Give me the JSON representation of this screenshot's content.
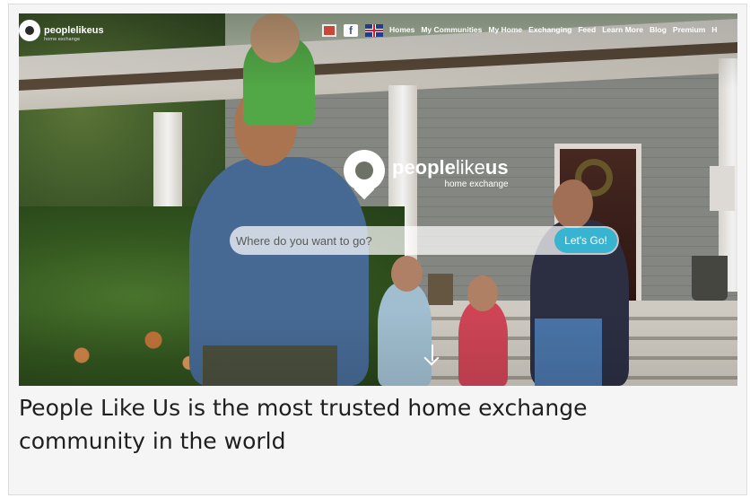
{
  "nav": {
    "brand": "peoplelikeus",
    "brand_sub": "home exchange",
    "icons": [
      "gift-icon",
      "facebook-icon",
      "uk-flag-icon"
    ],
    "facebook_glyph": "f",
    "items": [
      {
        "label": "Homes"
      },
      {
        "label": "My Communities"
      },
      {
        "label": "My Home"
      },
      {
        "label": "Exchanging"
      },
      {
        "label": "Feed"
      },
      {
        "label": "Learn More"
      },
      {
        "label": "Blog"
      },
      {
        "label": "Premium"
      },
      {
        "label": "H"
      }
    ]
  },
  "hero": {
    "logo_word_bold": "people",
    "logo_word_thin": "like",
    "logo_word_bold2": "us",
    "logo_sub": "home exchange",
    "search_placeholder": "Where do you want to go?",
    "search_value": "",
    "go_label": "Let's Go!",
    "accent_color": "#39b4d0"
  },
  "caption": "People Like Us is the most trusted home exchange community in the world"
}
